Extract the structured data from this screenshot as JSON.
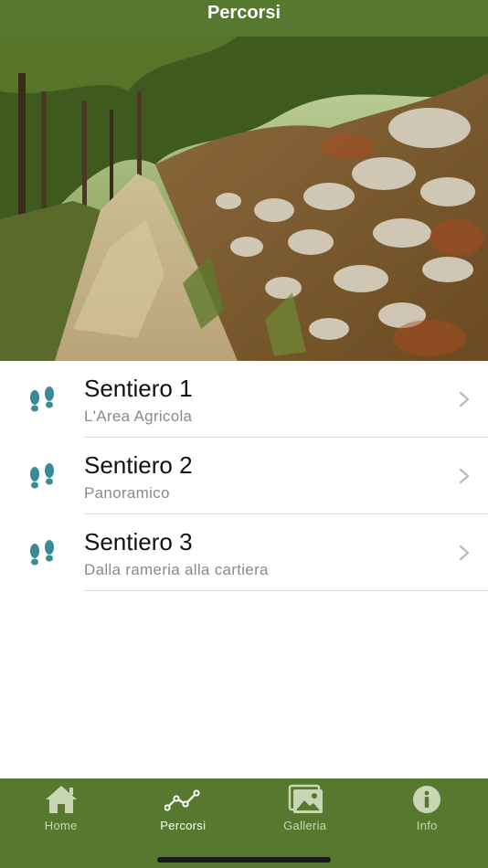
{
  "nav": {
    "title": "Percorsi"
  },
  "trails": [
    {
      "title": "Sentiero 1",
      "subtitle": "L'Area Agricola",
      "icon": "footprints-icon"
    },
    {
      "title": "Sentiero 2",
      "subtitle": "Panoramico",
      "icon": "footprints-icon"
    },
    {
      "title": "Sentiero 3",
      "subtitle": "Dalla rameria alla cartiera",
      "icon": "footprints-icon"
    }
  ],
  "tabs": [
    {
      "label": "Home",
      "icon": "house-icon",
      "active": false
    },
    {
      "label": "Percorsi",
      "icon": "route-icon",
      "active": true
    },
    {
      "label": "Galleria",
      "icon": "gallery-icon",
      "active": false
    },
    {
      "label": "Info",
      "icon": "info-icon",
      "active": false
    }
  ],
  "colors": {
    "brand": "#56782f",
    "icon_teal": "#3a8a96",
    "chevron": "#b9b9b9"
  }
}
